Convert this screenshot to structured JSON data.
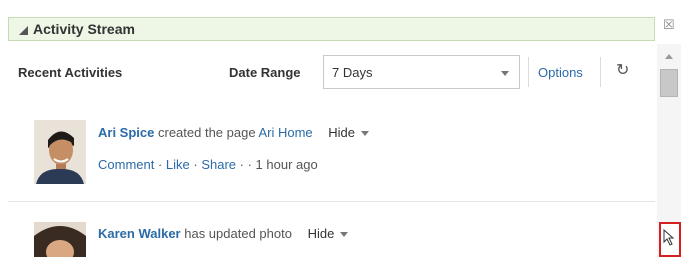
{
  "panel": {
    "title": "Activity Stream",
    "close_symbol": "☒"
  },
  "toolbar": {
    "recent_label": "Recent Activities",
    "date_range_label": "Date Range",
    "date_range_value": "7 Days",
    "options_label": "Options",
    "refresh_symbol": "↻"
  },
  "feed": {
    "items": [
      {
        "author": "Ari Spice",
        "action": "created the page",
        "target": "Ari Home",
        "hide_label": "Hide",
        "comment_label": "Comment",
        "like_label": "Like",
        "share_label": "Share",
        "time": "1 hour ago"
      },
      {
        "author": "Karen Walker",
        "action": "has updated photo",
        "hide_label": "Hide"
      }
    ]
  },
  "icons": {
    "collapse": "collapse-triangle-icon",
    "close": "close-icon",
    "refresh": "refresh-icon",
    "corner": "resize-cursor-icon"
  }
}
